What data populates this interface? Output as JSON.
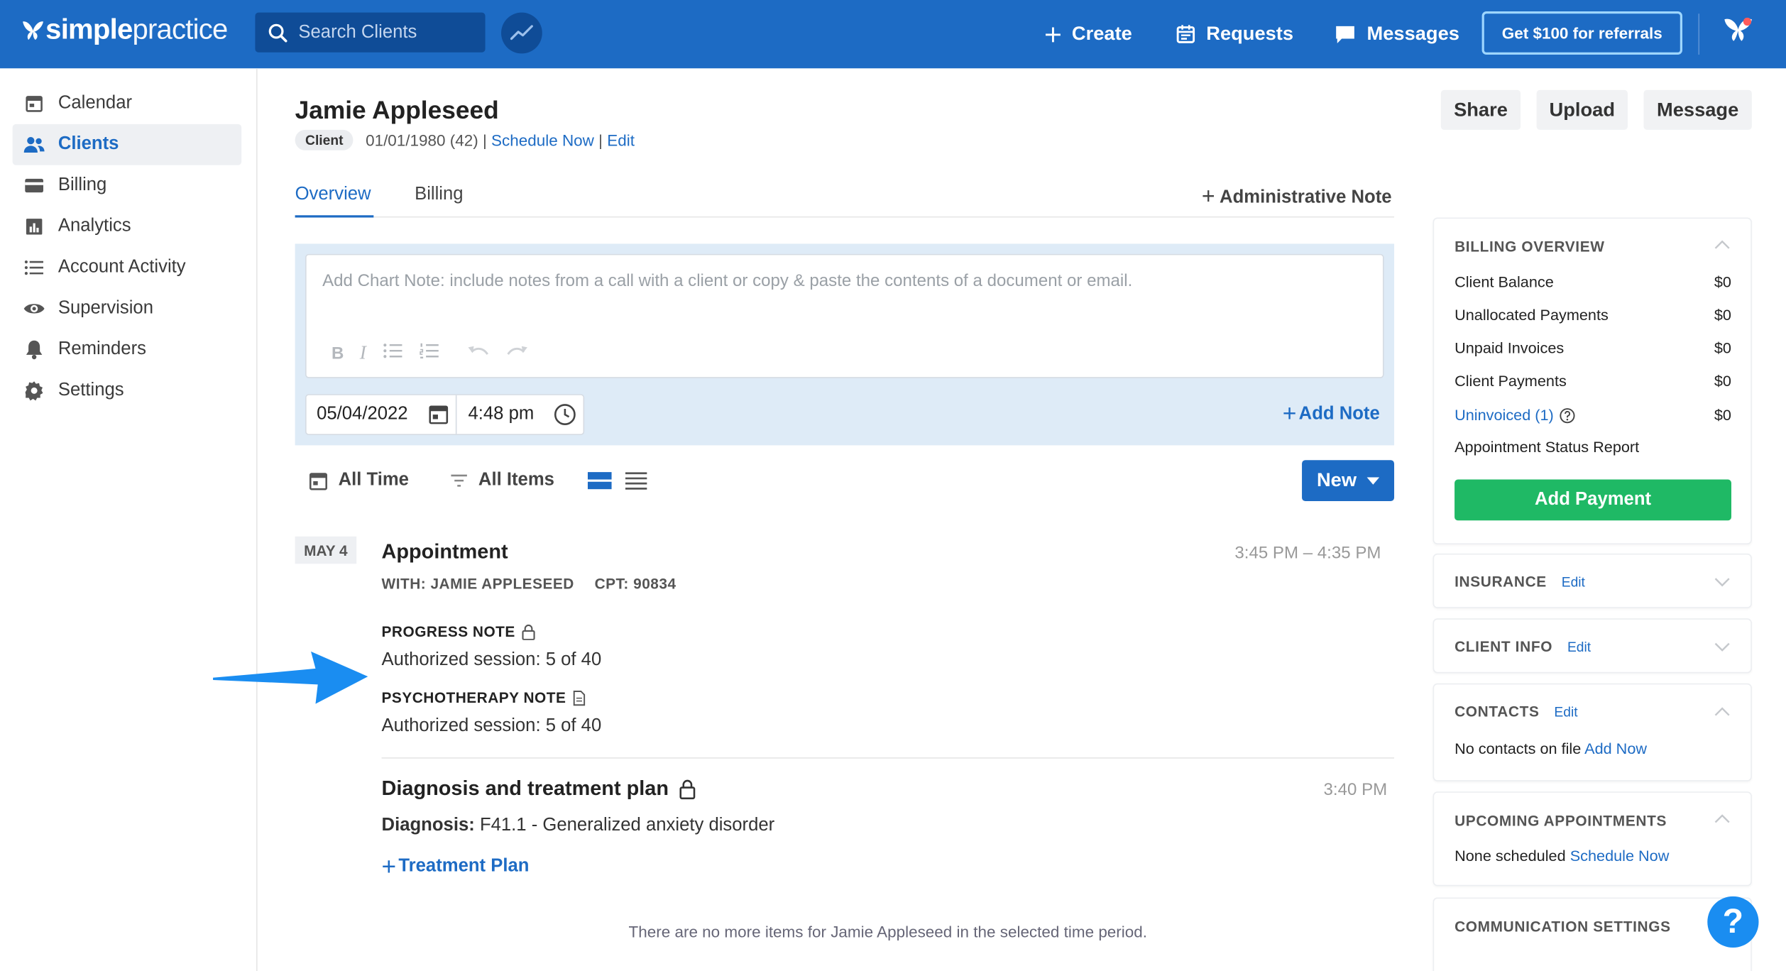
{
  "brand": {
    "name_bold": "simple",
    "name_light": "practice"
  },
  "search": {
    "placeholder": "Search Clients"
  },
  "topnav": {
    "create": "Create",
    "requests": "Requests",
    "messages": "Messages",
    "referral": "Get $100 for referrals"
  },
  "sidebar": {
    "items": [
      {
        "label": "Calendar",
        "icon": "calendar-icon"
      },
      {
        "label": "Clients",
        "icon": "clients-icon",
        "active": true
      },
      {
        "label": "Billing",
        "icon": "billing-icon"
      },
      {
        "label": "Analytics",
        "icon": "analytics-icon"
      },
      {
        "label": "Account Activity",
        "icon": "list-icon"
      },
      {
        "label": "Supervision",
        "icon": "eye-icon"
      },
      {
        "label": "Reminders",
        "icon": "bell-icon"
      },
      {
        "label": "Settings",
        "icon": "gear-icon"
      }
    ]
  },
  "client": {
    "name": "Jamie Appleseed",
    "badge": "Client",
    "dob": "01/01/1980 (42) |",
    "schedule_now": "Schedule Now",
    "sep": "|",
    "edit": "Edit"
  },
  "header_buttons": {
    "share": "Share",
    "upload": "Upload",
    "message": "Message"
  },
  "tabs": {
    "overview": "Overview",
    "billing": "Billing",
    "admin_note": "Administrative Note"
  },
  "chart_note": {
    "placeholder": "Add Chart Note: include notes from a call with a client or copy & paste the contents of a document or email.",
    "date": "05/04/2022",
    "time": "4:48 pm",
    "add_note": "Add Note"
  },
  "filters": {
    "time": "All Time",
    "items": "All Items",
    "new": "New"
  },
  "timeline": {
    "date_badge": "MAY 4",
    "appointment": {
      "title": "Appointment",
      "time": "3:45 PM – 4:35 PM",
      "with": "WITH: JAMIE APPLESEED",
      "cpt": "CPT: 90834"
    },
    "progress_note": {
      "label": "PROGRESS NOTE",
      "text": "Authorized session: 5 of 40"
    },
    "psychotherapy_note": {
      "label": "PSYCHOTHERAPY NOTE",
      "text": "Authorized session: 5 of 40"
    },
    "diagnosis": {
      "title": "Diagnosis and treatment plan",
      "time": "3:40 PM",
      "label": "Diagnosis:",
      "value": "F41.1 - Generalized anxiety disorder",
      "treatment_plan": "Treatment Plan"
    },
    "no_more": "There are no more items for Jamie Appleseed in the selected time period."
  },
  "billing_overview": {
    "title": "BILLING OVERVIEW",
    "rows": [
      {
        "label": "Client Balance",
        "value": "$0"
      },
      {
        "label": "Unallocated Payments",
        "value": "$0"
      },
      {
        "label": "Unpaid Invoices",
        "value": "$0"
      },
      {
        "label": "Client Payments",
        "value": "$0"
      },
      {
        "label": "Uninvoiced (1)",
        "value": "$0"
      }
    ],
    "status_report": "Appointment Status Report",
    "add_payment": "Add Payment"
  },
  "insurance": {
    "title": "INSURANCE",
    "edit": "Edit"
  },
  "client_info": {
    "title": "CLIENT INFO",
    "edit": "Edit"
  },
  "contacts": {
    "title": "CONTACTS",
    "edit": "Edit",
    "text": "No contacts on file",
    "add_now": "Add Now"
  },
  "upcoming": {
    "title": "UPCOMING APPOINTMENTS",
    "text": "None scheduled",
    "schedule_now": "Schedule Now"
  },
  "communication": {
    "title": "COMMUNICATION SETTINGS"
  },
  "help": {
    "label": "?"
  },
  "colors": {
    "primary": "#1d6bc4",
    "green": "#1fb965",
    "chart_bg": "#deebf7",
    "arrow": "#1a8df1"
  }
}
